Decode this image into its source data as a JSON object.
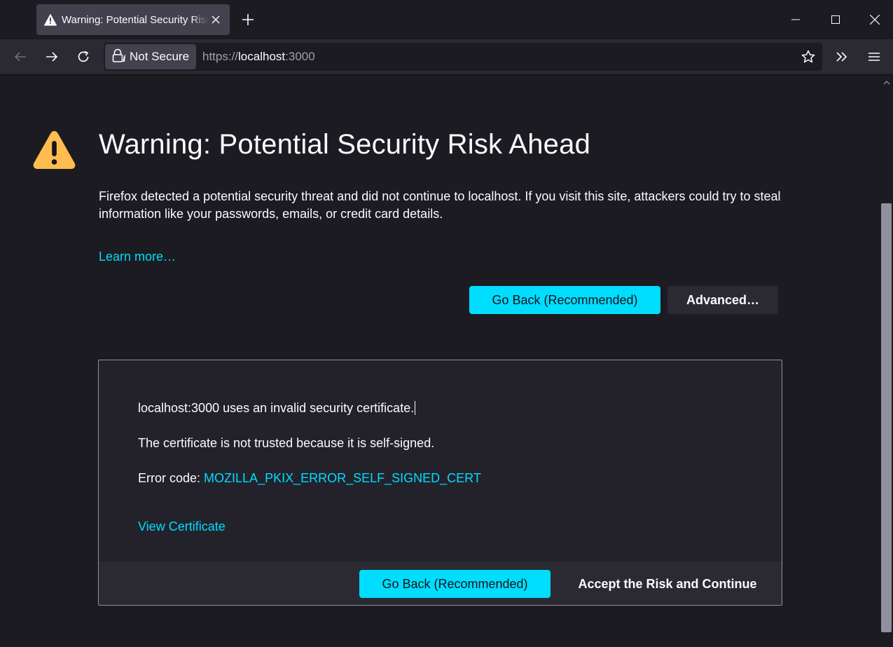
{
  "tab": {
    "title": "Warning: Potential Security Risk Ahead",
    "icon": "warning-icon"
  },
  "nav": {
    "identity_label": "Not Secure",
    "url_scheme": "https://",
    "url_host": "localhost",
    "url_port": ":3000"
  },
  "page": {
    "title": "Warning: Potential Security Risk Ahead",
    "description": "Firefox detected a potential security threat and did not continue to localhost. If you visit this site, attackers could try to steal information like your passwords, emails, or credit card details.",
    "learn_more": "Learn more…",
    "go_back_label": "Go Back (Recommended)",
    "advanced_label": "Advanced…"
  },
  "advanced_panel": {
    "line1": "localhost:3000 uses an invalid security certificate.",
    "line2": "The certificate is not trusted because it is self-signed.",
    "error_prefix": "Error code: ",
    "error_code": "MOZILLA_PKIX_ERROR_SELF_SIGNED_CERT",
    "view_certificate": "View Certificate",
    "go_back_label": "Go Back (Recommended)",
    "accept_label": "Accept the Risk and Continue"
  },
  "colors": {
    "accent": "#00ddff",
    "warning": "#ffbd4f",
    "background": "#1c1b22"
  }
}
